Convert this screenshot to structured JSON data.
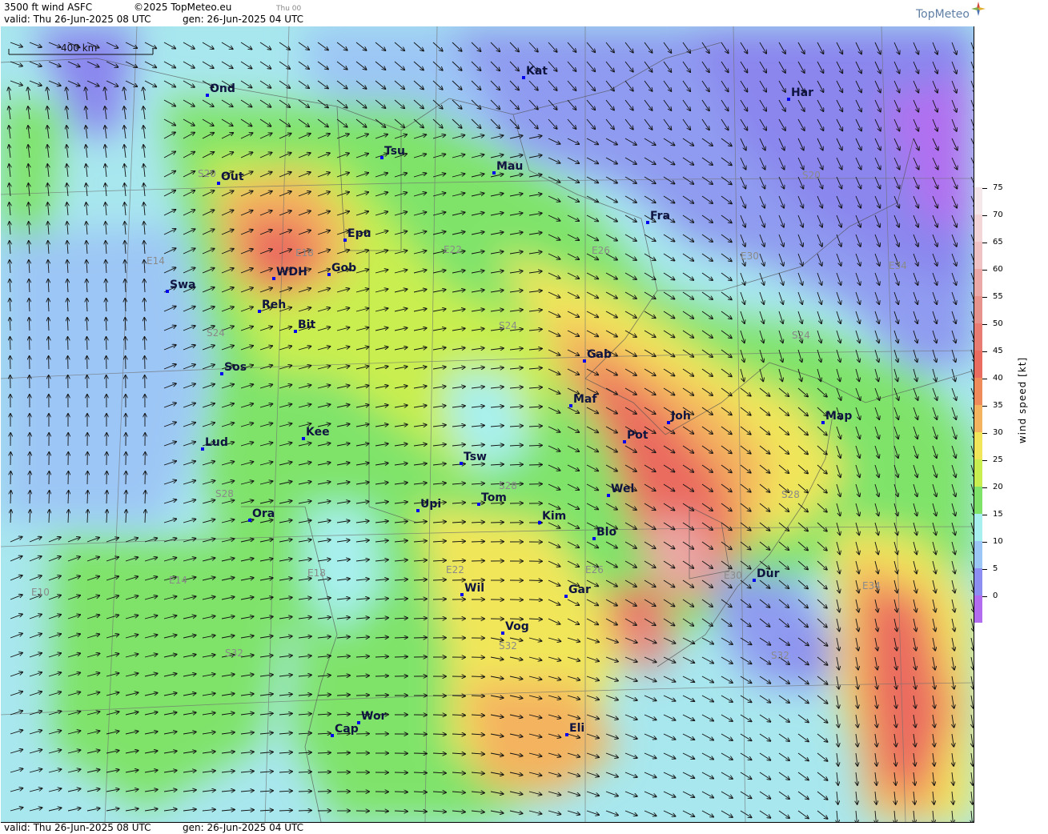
{
  "header": {
    "title": "3500 ft wind ASFC",
    "copyright": "©2025 TopMeteo.eu",
    "day_tag": "Thu 00",
    "valid": "valid:  Thu   26-Jun-2025  08 UTC",
    "gen": "gen:  26-Jun-2025 04 UTC"
  },
  "footer": {
    "valid": "valid:  Thu   26-Jun-2025  08 UTC",
    "gen": "gen:  26-Jun-2025 04 UTC"
  },
  "logo": {
    "text": "TopMeteo"
  },
  "scale_bar": {
    "label": "400 km"
  },
  "legend": {
    "title": "wind speed [kt]",
    "ticks": [
      "75",
      "70",
      "65",
      "60",
      "55",
      "50",
      "45",
      "40",
      "35",
      "30",
      "25",
      "20",
      "15",
      "10",
      "5",
      "0"
    ],
    "colors": [
      "#f4e8ea",
      "#f3d6d8",
      "#efc3c4",
      "#eaa9a6",
      "#e7938d",
      "#e87c73",
      "#ea6b5f",
      "#ef8a5b",
      "#f4b35f",
      "#f1e65a",
      "#c9ee4f",
      "#7fe36a",
      "#a8f0ef",
      "#9cc6f5",
      "#8d8ef2",
      "#b26cf0"
    ]
  },
  "cities": [
    {
      "name": "Kat"
    },
    {
      "name": "Ond"
    },
    {
      "name": "Har"
    },
    {
      "name": "Tsu"
    },
    {
      "name": "Out"
    },
    {
      "name": "Mau"
    },
    {
      "name": "Fra"
    },
    {
      "name": "Epu"
    },
    {
      "name": "WDH"
    },
    {
      "name": "Gob"
    },
    {
      "name": "Swa"
    },
    {
      "name": "Reh"
    },
    {
      "name": "Bit"
    },
    {
      "name": "Gab"
    },
    {
      "name": "Sos"
    },
    {
      "name": "Maf"
    },
    {
      "name": "Joh"
    },
    {
      "name": "Map"
    },
    {
      "name": "Pot"
    },
    {
      "name": "Lud"
    },
    {
      "name": "Kee"
    },
    {
      "name": "Tsw"
    },
    {
      "name": "Wel"
    },
    {
      "name": "Tom"
    },
    {
      "name": "Upi"
    },
    {
      "name": "Ora"
    },
    {
      "name": "Kim"
    },
    {
      "name": "Blo"
    },
    {
      "name": "Dur"
    },
    {
      "name": "Wil"
    },
    {
      "name": "Gar"
    },
    {
      "name": "Vog"
    },
    {
      "name": "Wor"
    },
    {
      "name": "Cap"
    },
    {
      "name": "Eli"
    }
  ],
  "grid_labels": [
    {
      "text": "S20"
    },
    {
      "text": "S20"
    },
    {
      "text": "S20"
    },
    {
      "text": "E14"
    },
    {
      "text": "E18"
    },
    {
      "text": "E22"
    },
    {
      "text": "E26"
    },
    {
      "text": "E30"
    },
    {
      "text": "E34"
    },
    {
      "text": "S24"
    },
    {
      "text": "S24"
    },
    {
      "text": "S24"
    },
    {
      "text": "S28"
    },
    {
      "text": "S28"
    },
    {
      "text": "S28"
    },
    {
      "text": "E10"
    },
    {
      "text": "E14"
    },
    {
      "text": "E18"
    },
    {
      "text": "E22"
    },
    {
      "text": "E26"
    },
    {
      "text": "E30"
    },
    {
      "text": "E34"
    },
    {
      "text": "S32"
    },
    {
      "text": "S32"
    },
    {
      "text": "S32"
    }
  ]
}
